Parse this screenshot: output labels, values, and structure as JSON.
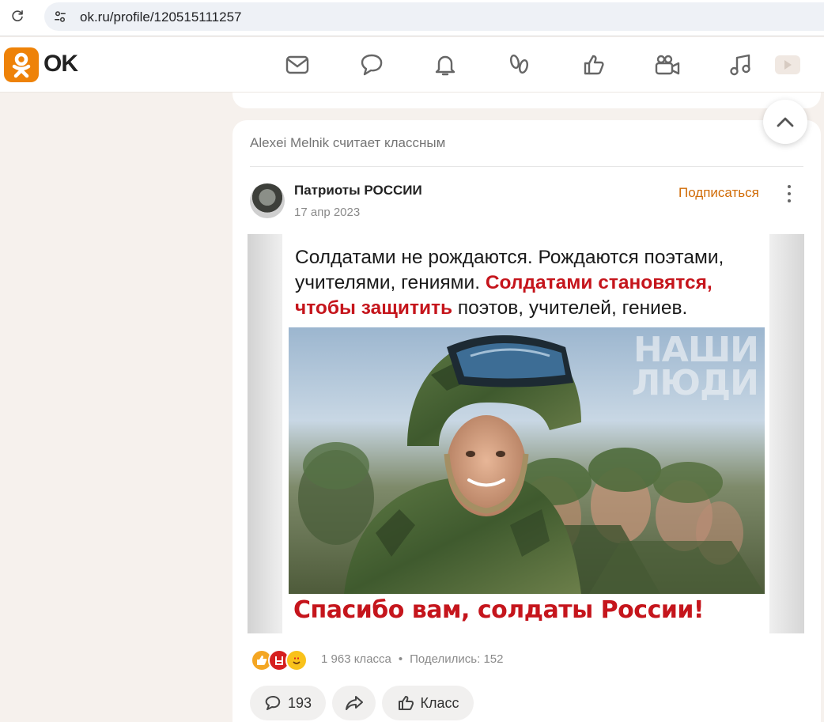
{
  "browser": {
    "url": "ok.ru/profile/120515111257"
  },
  "header": {
    "brand": "OK",
    "nav_icons": [
      "mail-icon",
      "chat-icon",
      "bell-icon",
      "guests-icon",
      "likes-icon",
      "video-icon",
      "music-icon",
      "video-play-icon"
    ]
  },
  "post": {
    "activity": "Alexei Melnik считает классным",
    "group_name": "Патриоты РОССИИ",
    "date": "17 апр 2023",
    "subscribe_label": "Подписаться",
    "caption_part1": "Солдатами не рождаются. Рождаются поэтами, учителями, гениями. ",
    "caption_red": "Солдатами становятся, чтобы защитить",
    "caption_part2": " поэтов, учителей, гениев.",
    "photo_watermark_line1": "НАШИ",
    "photo_watermark_line2": "ЛЮДИ",
    "slogan": "Спасибо вам, солдаты России!",
    "classes": "1 963 класса",
    "stats_separator": "•",
    "shares": "Поделились: 152",
    "comments_count": "193",
    "class_label": "Класс"
  },
  "colors": {
    "brand": "#ee8208",
    "subscribe": "#d06b06",
    "accent_red": "#c5151c"
  }
}
